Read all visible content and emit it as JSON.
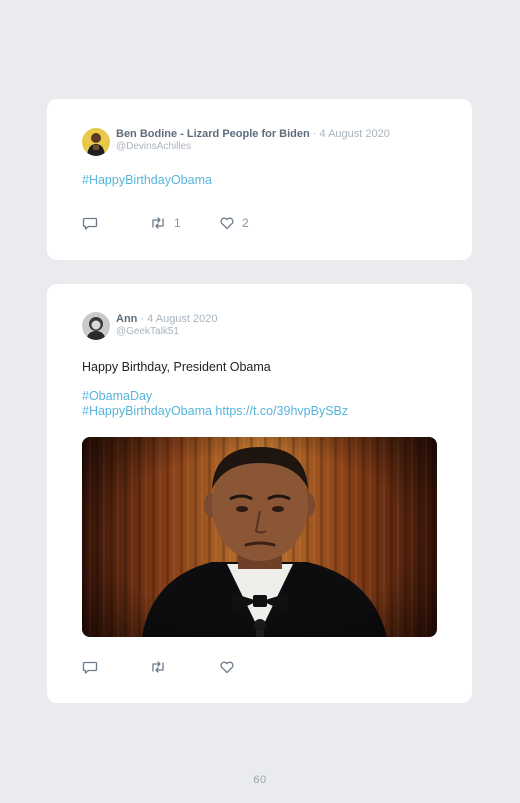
{
  "tweets": [
    {
      "author": "Ben Bodine - Lizard People for Biden",
      "date": " · 4 August 2020",
      "handle": "@DevinsAchilles",
      "text": "",
      "hashtags": [
        "#HappyBirthdayObama"
      ],
      "link": "",
      "replies": "",
      "retweets": "1",
      "likes": "2",
      "has_media": false
    },
    {
      "author": "Ann",
      "date": " · 4 August 2020",
      "handle": "@GeekTalk51",
      "text": "Happy Birthday, President Obama",
      "hashtags": [
        "#ObamaDay",
        "#HappyBirthdayObama"
      ],
      "link": "https://t.co/39hvpBySBz",
      "replies": "",
      "retweets": "",
      "likes": "",
      "has_media": true
    }
  ],
  "icons": {
    "reply": "speech-bubble-icon",
    "retweet": "retweet-arrows-icon",
    "like": "heart-outline-icon"
  },
  "colors": {
    "background": "#e9ebee",
    "card": "#ffffff",
    "hashtag": "#57b4dc",
    "author": "#5e6d7d",
    "meta": "#aab4be"
  },
  "page_number": "60"
}
